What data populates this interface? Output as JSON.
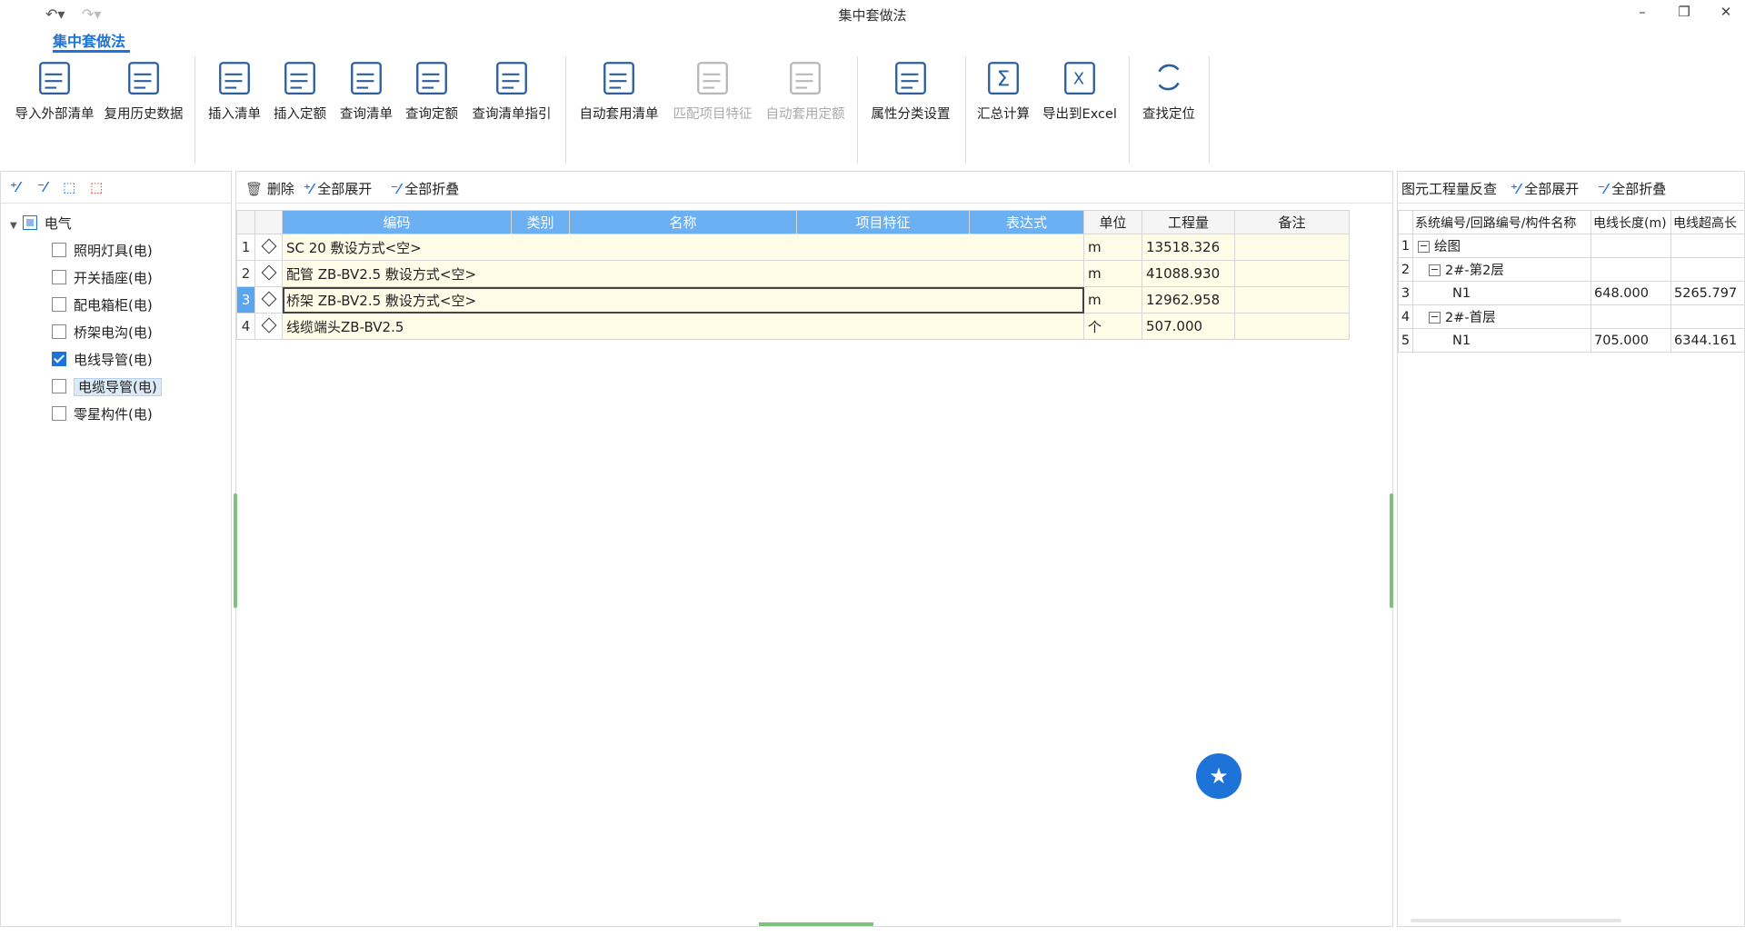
{
  "window": {
    "title": "集中套做法"
  },
  "ribbon": {
    "tab": "集中套做法",
    "buttons": [
      {
        "label": "导入外部清单",
        "icon": "import-list-icon",
        "disabled": false
      },
      {
        "label": "复用历史数据",
        "icon": "history-data-icon",
        "disabled": false
      },
      {
        "label": "插入清单",
        "icon": "insert-list-icon",
        "disabled": false
      },
      {
        "label": "插入定额",
        "icon": "insert-quota-icon",
        "disabled": false
      },
      {
        "label": "查询清单",
        "icon": "query-list-icon",
        "disabled": false
      },
      {
        "label": "查询定额",
        "icon": "query-quota-icon",
        "disabled": false
      },
      {
        "label": "查询清单指引",
        "icon": "query-guide-icon",
        "disabled": false
      },
      {
        "label": "自动套用清单",
        "icon": "auto-apply-list-icon",
        "disabled": false
      },
      {
        "label": "匹配项目特征",
        "icon": "match-feature-icon",
        "disabled": true
      },
      {
        "label": "自动套用定额",
        "icon": "auto-apply-quota-icon",
        "disabled": true
      },
      {
        "label": "属性分类设置",
        "icon": "attribute-settings-icon",
        "disabled": false
      },
      {
        "label": "汇总计算",
        "icon": "sigma-icon",
        "disabled": false
      },
      {
        "label": "导出到Excel",
        "icon": "excel-export-icon",
        "disabled": false
      },
      {
        "label": "查找定位",
        "icon": "locate-icon",
        "disabled": false
      }
    ]
  },
  "left_tree": {
    "root": "电气",
    "items": [
      {
        "label": "照明灯具(电)",
        "checked": false
      },
      {
        "label": "开关插座(电)",
        "checked": false
      },
      {
        "label": "配电箱柜(电)",
        "checked": false
      },
      {
        "label": "桥架电沟(电)",
        "checked": false
      },
      {
        "label": "电线导管(电)",
        "checked": true
      },
      {
        "label": "电缆导管(电)",
        "checked": false,
        "selected": true
      },
      {
        "label": "零星构件(电)",
        "checked": false
      }
    ]
  },
  "main_toolbar": {
    "delete": "删除",
    "expand_all": "全部展开",
    "collapse_all": "全部折叠"
  },
  "main_grid": {
    "headers": [
      "编码",
      "类别",
      "名称",
      "项目特征",
      "表达式",
      "单位",
      "工程量",
      "备注"
    ],
    "rows": [
      {
        "idx": "1",
        "text": "SC 20 敷设方式<空>",
        "unit": "m",
        "qty": "13518.326",
        "note": ""
      },
      {
        "idx": "2",
        "text": "配管 ZB-BV2.5 敷设方式<空>",
        "unit": "m",
        "qty": "41088.930",
        "note": ""
      },
      {
        "idx": "3",
        "text": "桥架 ZB-BV2.5 敷设方式<空>",
        "unit": "m",
        "qty": "12962.958",
        "note": "",
        "selected": true
      },
      {
        "idx": "4",
        "text": "线缆端头ZB-BV2.5",
        "unit": "个",
        "qty": "507.000",
        "note": ""
      }
    ]
  },
  "right_panel": {
    "title": "图元工程量反查",
    "expand_all": "全部展开",
    "collapse_all": "全部折叠",
    "headers": [
      "系统编号/回路编号/构件名称",
      "电线长度(m)",
      "电线超高长"
    ],
    "rows": [
      {
        "idx": "1",
        "level": 0,
        "toggle": "−",
        "label": "绘图",
        "len": "",
        "over": ""
      },
      {
        "idx": "2",
        "level": 1,
        "toggle": "−",
        "label": "2#-第2层",
        "len": "",
        "over": ""
      },
      {
        "idx": "3",
        "level": 2,
        "toggle": "",
        "label": "N1",
        "len": "648.000",
        "over": "5265.797"
      },
      {
        "idx": "4",
        "level": 1,
        "toggle": "−",
        "label": "2#-首层",
        "len": "",
        "over": ""
      },
      {
        "idx": "5",
        "level": 2,
        "toggle": "",
        "label": "N1",
        "len": "705.000",
        "over": "6344.161"
      }
    ]
  },
  "colors": {
    "accent": "#1e73d8",
    "header_blue": "#6ab0f3",
    "row_yellow": "#fffce8"
  }
}
